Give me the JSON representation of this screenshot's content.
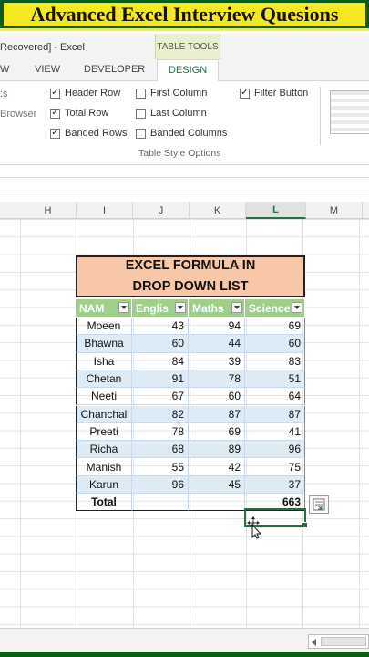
{
  "banner": {
    "text": "Advanced Excel Interview Quesions"
  },
  "titlebar": {
    "title": "Recovered] - Excel",
    "context_tab": "TABLE TOOLS"
  },
  "tabs": {
    "items": [
      "W",
      "VIEW",
      "DEVELOPER",
      "DESIGN"
    ],
    "active": "DESIGN"
  },
  "ribbon": {
    "left_cut": [
      ":s",
      "Browser"
    ],
    "options": {
      "header_row": {
        "label": "Header Row",
        "checked": true
      },
      "total_row": {
        "label": "Total Row",
        "checked": true
      },
      "banded_rows": {
        "label": "Banded Rows",
        "checked": true
      },
      "first_column": {
        "label": "First Column",
        "checked": false
      },
      "last_column": {
        "label": "Last Column",
        "checked": false
      },
      "banded_columns": {
        "label": "Banded Columns",
        "checked": false
      },
      "filter_button": {
        "label": "Filter Button",
        "checked": true
      }
    },
    "group_label": "Table Style Options"
  },
  "columns": [
    "H",
    "I",
    "J",
    "K",
    "L",
    "M"
  ],
  "selected_column": "L",
  "table": {
    "title_line1": "EXCEL FORMULA IN",
    "title_line2": "DROP DOWN LIST",
    "headers": [
      "NAM",
      "Englis",
      "Maths",
      "Science"
    ],
    "rows": [
      {
        "name": "Moeen",
        "english": "43",
        "maths": "94",
        "science": "69"
      },
      {
        "name": "Bhawna",
        "english": "60",
        "maths": "44",
        "science": "60"
      },
      {
        "name": "Isha",
        "english": "84",
        "maths": "39",
        "science": "83"
      },
      {
        "name": "Chetan",
        "english": "91",
        "maths": "78",
        "science": "51"
      },
      {
        "name": "Neeti",
        "english": "67",
        "maths": "60",
        "science": "64"
      },
      {
        "name": "Chanchal",
        "english": "82",
        "maths": "87",
        "science": "87"
      },
      {
        "name": "Preeti",
        "english": "78",
        "maths": "69",
        "science": "41"
      },
      {
        "name": "Richa",
        "english": "68",
        "maths": "89",
        "science": "96"
      },
      {
        "name": "Manish",
        "english": "55",
        "maths": "42",
        "science": "75"
      },
      {
        "name": "Karun",
        "english": "96",
        "maths": "45",
        "science": "37"
      }
    ],
    "total": {
      "label": "Total",
      "english": "",
      "maths": "",
      "science": "663"
    }
  },
  "colors": {
    "excel_green": "#217346",
    "header_green": "#9ed08a",
    "title_fill": "#f7c7a7",
    "band_blue": "#ddebf7",
    "banner_yellow": "#f4e823"
  },
  "icons": {
    "quick_analysis": "quick-analysis-icon",
    "cursor": "move-cursor-icon"
  }
}
